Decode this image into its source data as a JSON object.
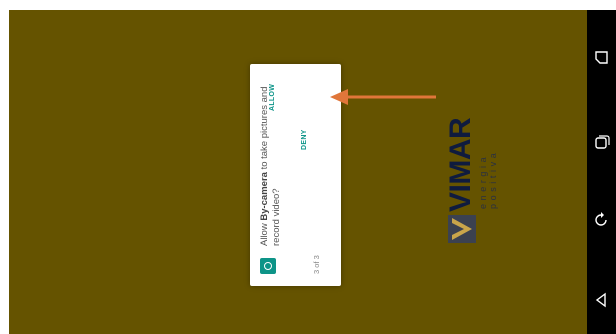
{
  "dialog": {
    "message_prefix": "Allow ",
    "app_name": "By-camera",
    "message_suffix": " to take pictures and record video?",
    "counter": "3 of 3",
    "deny_label": "DENY",
    "allow_label": "ALLOW",
    "icon": "camera-icon"
  },
  "logo": {
    "brand": "VIMAR",
    "tagline": "energia positiva"
  },
  "navbar": {
    "icons": [
      "recents-icon",
      "copy-icon",
      "back-icon",
      "home-icon"
    ]
  },
  "colors": {
    "screen_background": "#655300",
    "accent": "#0d9488",
    "annotation_arrow": "#e0763a",
    "brand": "#0f1b3e"
  }
}
